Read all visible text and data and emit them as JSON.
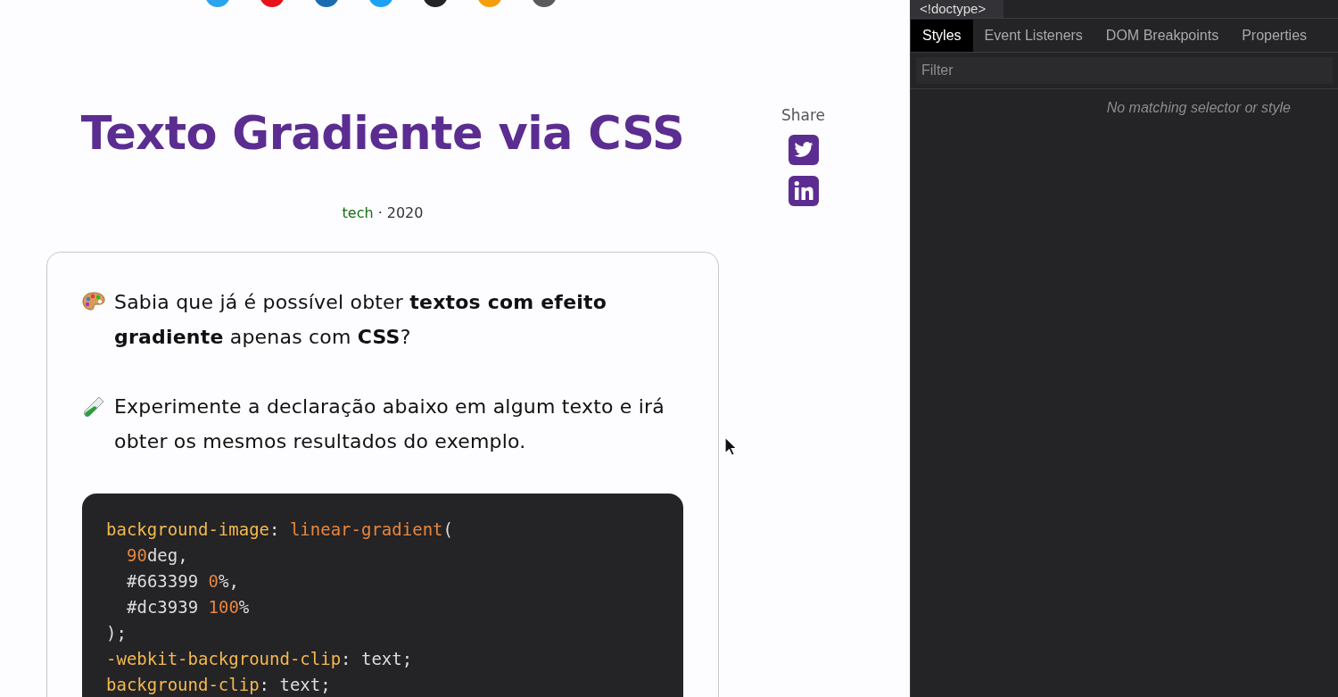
{
  "social_links": [
    {
      "color": "#2ba3ee"
    },
    {
      "color": "#e8121c"
    },
    {
      "color": "#1a6cb0"
    },
    {
      "color": "#1da1f2"
    },
    {
      "color": "#242424"
    },
    {
      "color": "#f59e0b"
    },
    {
      "color": "#5a595b"
    }
  ],
  "article": {
    "title": "Texto Gradiente via CSS",
    "category": "tech",
    "separator": "·",
    "year": "2020",
    "paragraphs": [
      {
        "kind": "palette",
        "text": "Sabia que já é possível obter **textos com efeito gradiente** apenas com **CSS**?"
      },
      {
        "kind": "test-tube",
        "text": "Experimente a declaração abaixo em algum texto e irá obter os mesmos resultados do exemplo."
      }
    ],
    "code_lines": [
      {
        "indented": false,
        "tokens": [
          {
            "kind": "prop",
            "text": "background-image"
          },
          {
            "kind": "plain",
            "text": ": "
          },
          {
            "kind": "value",
            "text": "linear-gradient"
          },
          {
            "kind": "plain",
            "text": "("
          }
        ]
      },
      {
        "indented": true,
        "tokens": [
          {
            "kind": "number",
            "text": "90"
          },
          {
            "kind": "plain",
            "text": "deg,"
          }
        ]
      },
      {
        "indented": true,
        "tokens": [
          {
            "kind": "plain",
            "text": "#663399 "
          },
          {
            "kind": "number",
            "text": "0"
          },
          {
            "kind": "plain",
            "text": "%,"
          }
        ]
      },
      {
        "indented": true,
        "tokens": [
          {
            "kind": "plain",
            "text": "#dc3939 "
          },
          {
            "kind": "number",
            "text": "100"
          },
          {
            "kind": "plain",
            "text": "%"
          }
        ]
      },
      {
        "indented": false,
        "tokens": [
          {
            "kind": "plain",
            "text": ");"
          }
        ]
      },
      {
        "indented": false,
        "tokens": [
          {
            "kind": "prop",
            "text": "-webkit-background-clip"
          },
          {
            "kind": "plain",
            "text": ": text;"
          }
        ]
      },
      {
        "indented": false,
        "tokens": [
          {
            "kind": "prop",
            "text": "background-clip"
          },
          {
            "kind": "plain",
            "text": ": text;"
          }
        ]
      }
    ]
  },
  "share": {
    "label": "Share",
    "buttons": [
      {
        "kind": "twitter"
      },
      {
        "kind": "linkedin"
      }
    ]
  },
  "devtools": {
    "breadcrumb": "<!doctype>",
    "tabs": [
      {
        "label": "Styles",
        "selected": true
      },
      {
        "label": "Event Listeners",
        "selected": false
      },
      {
        "label": "DOM Breakpoints",
        "selected": false
      },
      {
        "label": "Properties",
        "selected": false
      }
    ],
    "filter": {
      "placeholder": "Filter"
    },
    "empty_message": "No matching selector or style"
  }
}
